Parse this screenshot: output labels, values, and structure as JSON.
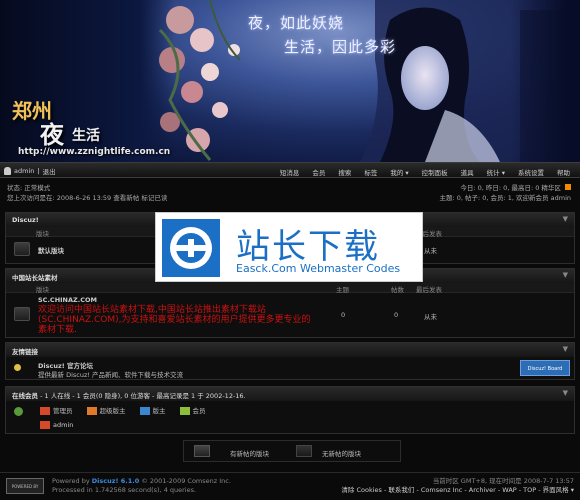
{
  "banner": {
    "poem_line1": "夜，如此妖娆",
    "poem_line2": "生活，因此多彩",
    "logo_line1": "郑州",
    "logo_big": "夜",
    "logo_small": "生活",
    "url": "http://www.zznightlife.com.cn"
  },
  "navbar": {
    "user": "admin",
    "logout": "退出",
    "links": [
      "短消息",
      "会员",
      "搜索",
      "标签",
      "我的 ▾",
      "控制面板",
      "道具",
      "统计 ▾",
      "系统设置",
      "帮助"
    ]
  },
  "status": {
    "mode": "状态: 正常模式",
    "last_visit": "您上次访问是在: 2008-6-26 13:59  查看新帖  标记已读",
    "today": "今日: 0, 昨日: 0, 最高日: 0   精华区",
    "stats": "主题: 0, 帖子: 0, 会员: 1, 欢迎新会员 admin"
  },
  "forum1": {
    "title": "Discuz!",
    "col_board": "版块",
    "col_last": "最后发表",
    "board_name": "默认版块",
    "last": "从未"
  },
  "forum2": {
    "title": "中国站长站素材",
    "col_board": "版块",
    "col_topics": "主题",
    "col_posts": "帖数",
    "col_last": "最后发表",
    "board_name": "SC.CHINAZ.COM",
    "desc": "欢迎访问中国站长站素材下载,中国站长站推出素材下载站(SC.CHINAZ.COM),为支持和喜爱站长素材的用户提供更多更专业的素材下载.",
    "topics": "0",
    "posts": "0",
    "last": "从未"
  },
  "links_box": {
    "title": "友情链接",
    "name": "Discuz! 官方论坛",
    "desc": "提供最新 Discuz! 产品新闻、软件下载与技术交流",
    "badge": "Discuz! Board"
  },
  "online": {
    "title": "在线会员",
    "summary": "- 1 人在线 - 1 会员(0 隐身), 0 位游客 - 最高记录是 1 于 2002-12-16.",
    "legend": [
      "管理员",
      "超级版主",
      "版主",
      "会员"
    ],
    "user": "admin"
  },
  "legend": {
    "new": "有新帖的版块",
    "none": "无新帖的版块"
  },
  "watermark": {
    "title": "站长下载",
    "sub": "Easck.Com Webmaster Codes"
  },
  "footer": {
    "powered": "Powered by",
    "product": "Discuz! 6.1.0",
    "copyright": "© 2001-2009 Comsenz Inc.",
    "processed": "Processed in 1.742568 second(s), 4 queries.",
    "timezone": "当前时区 GMT+8, 现在时间是 2008-7-7 13:57",
    "links": "清除 Cookies - 联系我们 - Comsenz Inc - Archiver - WAP - TOP - 界面风格 ▾",
    "badge": "POWERED BY DISCUZ!"
  },
  "colors": {
    "accent_red": "#cc1111",
    "watermark_blue": "#1b6fc4",
    "orange_bar": "#ff9900"
  }
}
